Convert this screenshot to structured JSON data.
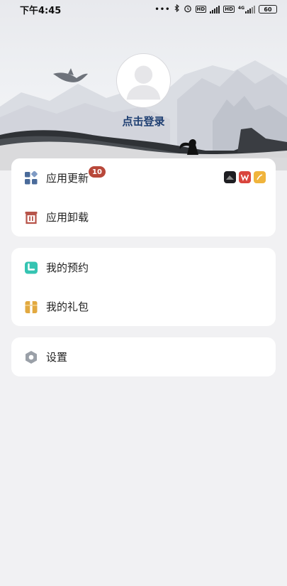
{
  "status": {
    "time": "下午4:45",
    "icons": [
      "dots-icon",
      "bluetooth-icon",
      "alarm-icon",
      "hd-icon",
      "signal-icon",
      "hd-icon",
      "signal-4g-icon"
    ],
    "net_label": "4G",
    "battery": "60"
  },
  "profile": {
    "avatar_icon": "user-avatar-icon",
    "login_text": "点击登录"
  },
  "menu_group_1": {
    "update": {
      "icon": "grid-apps-icon",
      "label": "应用更新",
      "badge": "10",
      "app_icons": [
        "black-app-icon",
        "wps-app-icon",
        "yellow-app-icon"
      ]
    },
    "uninstall": {
      "icon": "trash-icon",
      "label": "应用卸载"
    }
  },
  "menu_group_2": {
    "reservation": {
      "icon": "calendar-icon",
      "label": "我的预约"
    },
    "gift": {
      "icon": "gift-icon",
      "label": "我的礼包"
    }
  },
  "menu_group_3": {
    "settings": {
      "icon": "hexagon-gear-icon",
      "label": "设置"
    }
  },
  "colors": {
    "accent_blue": "#4a6b9a",
    "badge_red": "#b8483a",
    "trash_red": "#b7544a",
    "calendar_teal": "#35c4b2",
    "gift_gold": "#e2a940",
    "settings_gray": "#9aa0a8",
    "login_blue": "#1f3f72"
  }
}
